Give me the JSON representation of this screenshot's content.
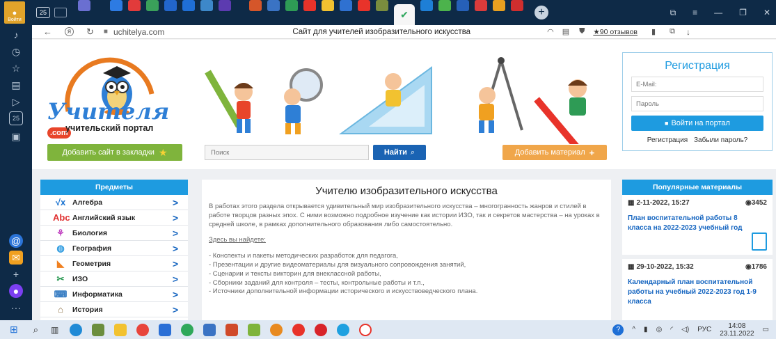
{
  "tabbar": {
    "login_label": "Войти",
    "tab_count": "25",
    "window_controls": [
      "□",
      "≡",
      "—",
      "❐",
      "✕"
    ]
  },
  "address": {
    "url": "uchitelya.com",
    "title": "Сайт для учителей изобразительного искусства",
    "reviews": "★90 отзывов"
  },
  "sidebar_left": {
    "counter": "25"
  },
  "site": {
    "logo_main": "Учителя",
    "logo_com": ".com",
    "logo_sub": "учительский портал",
    "bookmark_button": "Добавить сайт в закладки",
    "search_placeholder": "Поиск",
    "search_button": "Найти",
    "add_material_button": "Добавить материал",
    "colors": {
      "green": "#7fb43c",
      "blue": "#1a73c4",
      "orange": "#f0a64a",
      "sky": "#1e9be0"
    }
  },
  "register": {
    "title": "Регистрация",
    "email_placeholder": "E-Mail:",
    "password_placeholder": "Пароль",
    "login_button": "Войти на портал",
    "register_link": "Регистрация",
    "forgot_link": "Забыли пароль?"
  },
  "subjects": {
    "header": "Предметы",
    "items": [
      {
        "label": "Алгебра",
        "icon": "√x"
      },
      {
        "label": "Английский язык",
        "icon": "Abc"
      },
      {
        "label": "Биология",
        "icon": "⚘"
      },
      {
        "label": "География",
        "icon": "◍"
      },
      {
        "label": "Геометрия",
        "icon": "◣"
      },
      {
        "label": "ИЗО",
        "icon": "✂"
      },
      {
        "label": "Информатика",
        "icon": "⌨"
      },
      {
        "label": "История",
        "icon": "⌂"
      }
    ]
  },
  "article": {
    "title": "Учителю изобразительного искусства",
    "intro": "В работах этого раздела открывается удивительный мир изобразительного искусства – многогранность жанров и стилей в работе творцов разных эпох. С ними возможно подробное изучение как истории ИЗО, так и секретов мастерства – на уроках в средней школе, в рамках дополнительного образования либо самостоятельно.",
    "here_label": "Здесь вы найдете:",
    "list": [
      "- Конспекты и пакеты методических разработок для педагога,",
      "- Презентации и другие видеоматериалы для визуального сопровождения занятий,",
      "- Сценарии и тексты викторин для внеклассной работы,",
      "- Сборники заданий для контроля – тесты, контрольные работы и т.п.,",
      "- Источники дополнительной информации исторического и искусствоведческого плана."
    ]
  },
  "popular": {
    "header": "Популярные материалы",
    "items": [
      {
        "date": "2-11-2022, 15:27",
        "views": "3452",
        "title": "План воспитательной работы 8 класса на 2022-2023 учебный год"
      },
      {
        "date": "29-10-2022, 15:32",
        "views": "1786",
        "title": "Календарный план воспитательной работы на учебный 2022-2023 год 1-9 класса"
      }
    ]
  },
  "taskbar": {
    "lang": "РУС",
    "time": "14:08",
    "date": "23.11.2022"
  }
}
